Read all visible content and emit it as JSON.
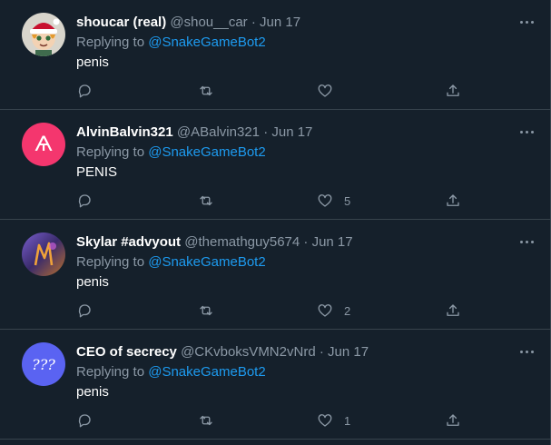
{
  "accent": "#1d9bf0",
  "tweets": [
    {
      "display_name": "shoucar (real)",
      "handle": "@shou__car",
      "date": "Jun 17",
      "replying_prefix": "Replying to",
      "replying_to": "@SnakeGameBot2",
      "text": "penis",
      "likes": "",
      "avatar": "cartoon-santa-hat-avatar"
    },
    {
      "display_name": "AlvinBalvin321",
      "handle": "@ABalvin321",
      "date": "Jun 17",
      "replying_prefix": "Replying to",
      "replying_to": "@SnakeGameBot2",
      "text": "PENIS",
      "likes": "5",
      "avatar_glyph": "Ѧ",
      "avatar_color": "#f4366e"
    },
    {
      "display_name": "Skylar #advyout",
      "handle": "@themathguy5674",
      "date": "Jun 17",
      "replying_prefix": "Replying to",
      "replying_to": "@SnakeGameBot2",
      "text": "penis",
      "likes": "2",
      "avatar": "purple-art-avatar"
    },
    {
      "display_name": "CEO of secrecy",
      "handle": "@CKvboksVMN2vNrd",
      "date": "Jun 17",
      "replying_prefix": "Replying to",
      "replying_to": "@SnakeGameBot2",
      "text": "penis",
      "likes": "1",
      "avatar_glyph": "???",
      "avatar_color": "#5a63f2"
    }
  ]
}
